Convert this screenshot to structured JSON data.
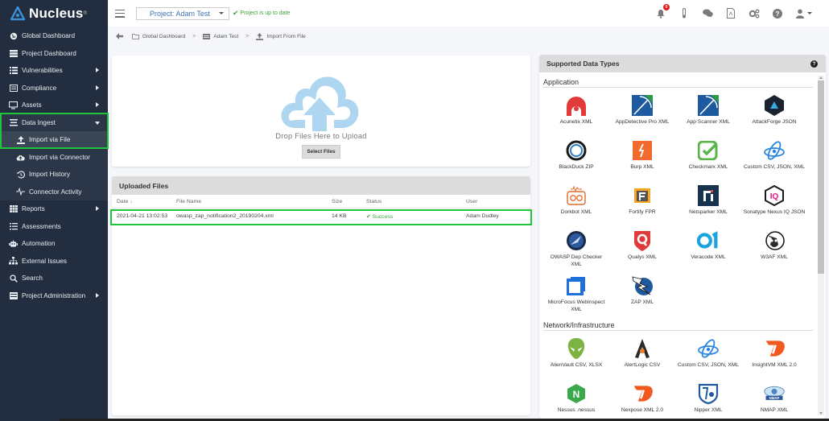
{
  "brand": {
    "name": "Nucleus",
    "reg": "®"
  },
  "sidebar": {
    "items": [
      {
        "label": "Global Dashboard",
        "icon": "globe-icon"
      },
      {
        "label": "Project Dashboard",
        "icon": "dashboard-icon"
      },
      {
        "label": "Vulnerabilities",
        "icon": "list-icon",
        "has_submenu": true
      },
      {
        "label": "Compliance",
        "icon": "compliance-icon",
        "has_submenu": true
      },
      {
        "label": "Assets",
        "icon": "monitor-icon",
        "has_submenu": true
      },
      {
        "label": "Data Ingest",
        "icon": "stack-icon",
        "expanded": true
      },
      {
        "label": "Import via File",
        "icon": "upload-icon",
        "sub": true,
        "active": true
      },
      {
        "label": "Import via Connector",
        "icon": "cloud-upload-icon",
        "sub": true
      },
      {
        "label": "Import History",
        "icon": "history-icon",
        "sub": true
      },
      {
        "label": "Connector Activity",
        "icon": "pulse-icon",
        "sub": true
      },
      {
        "label": "Reports",
        "icon": "grid-icon",
        "has_submenu": true
      },
      {
        "label": "Assessments",
        "icon": "checklist-icon"
      },
      {
        "label": "Automation",
        "icon": "robot-icon"
      },
      {
        "label": "External Issues",
        "icon": "sitemap-icon"
      },
      {
        "label": "Search",
        "icon": "search-icon"
      },
      {
        "label": "Project Administration",
        "icon": "admin-icon",
        "has_submenu": true
      }
    ]
  },
  "header": {
    "project_label": "Project: Adam Test",
    "status_text": "Project is up to date",
    "notification_count": "0"
  },
  "breadcrumb": {
    "items": [
      "Global Dashboard",
      "Adam Test",
      "Import From File"
    ]
  },
  "upload": {
    "drop_text": "Drop Files Here to Upload",
    "select_button": "Select Files"
  },
  "uploaded_files": {
    "title": "Uploaded Files",
    "columns": [
      "Date",
      "File Name",
      "Size",
      "Status",
      "User"
    ],
    "rows": [
      {
        "date": "2021-04-21 13:02:53",
        "file": "owasp_zap_notification2_20190204.xml",
        "size": "14 KB",
        "status": "Success",
        "user": "Adam Dudley"
      }
    ]
  },
  "supported": {
    "title": "Supported Data Types",
    "sections": [
      {
        "title": "Application",
        "items": [
          "Acunetix XML",
          "AppDetective Pro XML",
          "App Scanner XML",
          "AttackForge JSON",
          "BlackDuck ZIP",
          "Burp XML",
          "Checkmarx XML",
          "Custom CSV, JSON, XML",
          "Dorkbot XML",
          "Fortify FPR",
          "Netsparker XML",
          "Sonatype Nexus IQ JSON",
          "OWASP Dep Checker XML",
          "Qualys XML",
          "Veracode XML",
          "W3AF XML",
          "MicroFocus WebInspect XML",
          "ZAP XML"
        ]
      },
      {
        "title": "Network/Infrastructure",
        "items": [
          "AlienVault CSV, XLSX",
          "AlertLogic CSV",
          "Custom CSV, JSON, XML",
          "InsightVM XML 2.0",
          "Nessus .nessus",
          "Nexpose XML 2.0",
          "Nipper XML",
          "NMAP XML"
        ]
      }
    ]
  },
  "colors": {
    "sidebar_bg": "#222d3f",
    "highlight": "#1fc63a",
    "success": "#3aa33a",
    "link": "#3b73b0"
  }
}
